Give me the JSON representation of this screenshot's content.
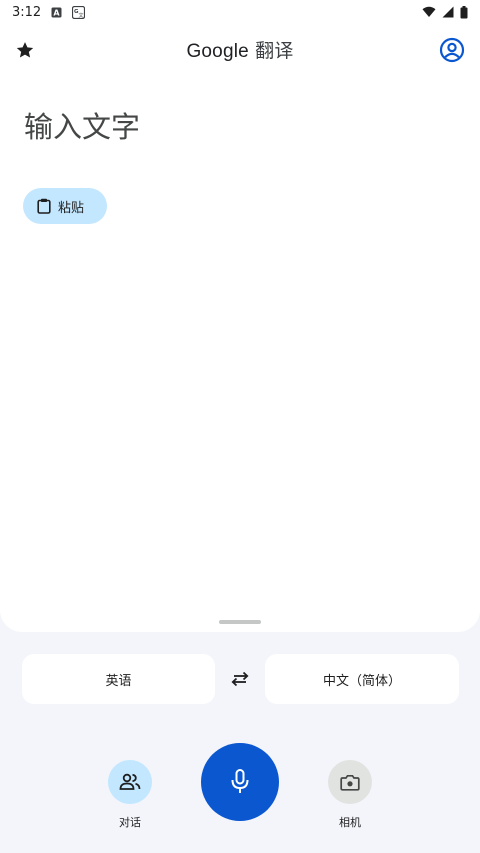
{
  "status_bar": {
    "time": "3:12",
    "icons": [
      "a-notification-icon",
      "translate-notification-icon",
      "wifi-icon",
      "signal-icon",
      "battery-icon"
    ]
  },
  "app_bar": {
    "brand": "Google",
    "title": "翻译",
    "left_icon": "star-icon",
    "right_icon": "account-icon"
  },
  "input": {
    "placeholder": "输入文字"
  },
  "paste": {
    "label": "粘贴",
    "icon": "clipboard-icon"
  },
  "languages": {
    "source": "英语",
    "target": "中文（简体）",
    "swap_icon": "swap-icon"
  },
  "actions": {
    "conversation_label": "对话",
    "camera_label": "相机",
    "mic_icon": "mic-icon"
  },
  "colors": {
    "accent": "#0b57d0",
    "chip": "#c2e7ff",
    "background": "#f3f5fb"
  }
}
